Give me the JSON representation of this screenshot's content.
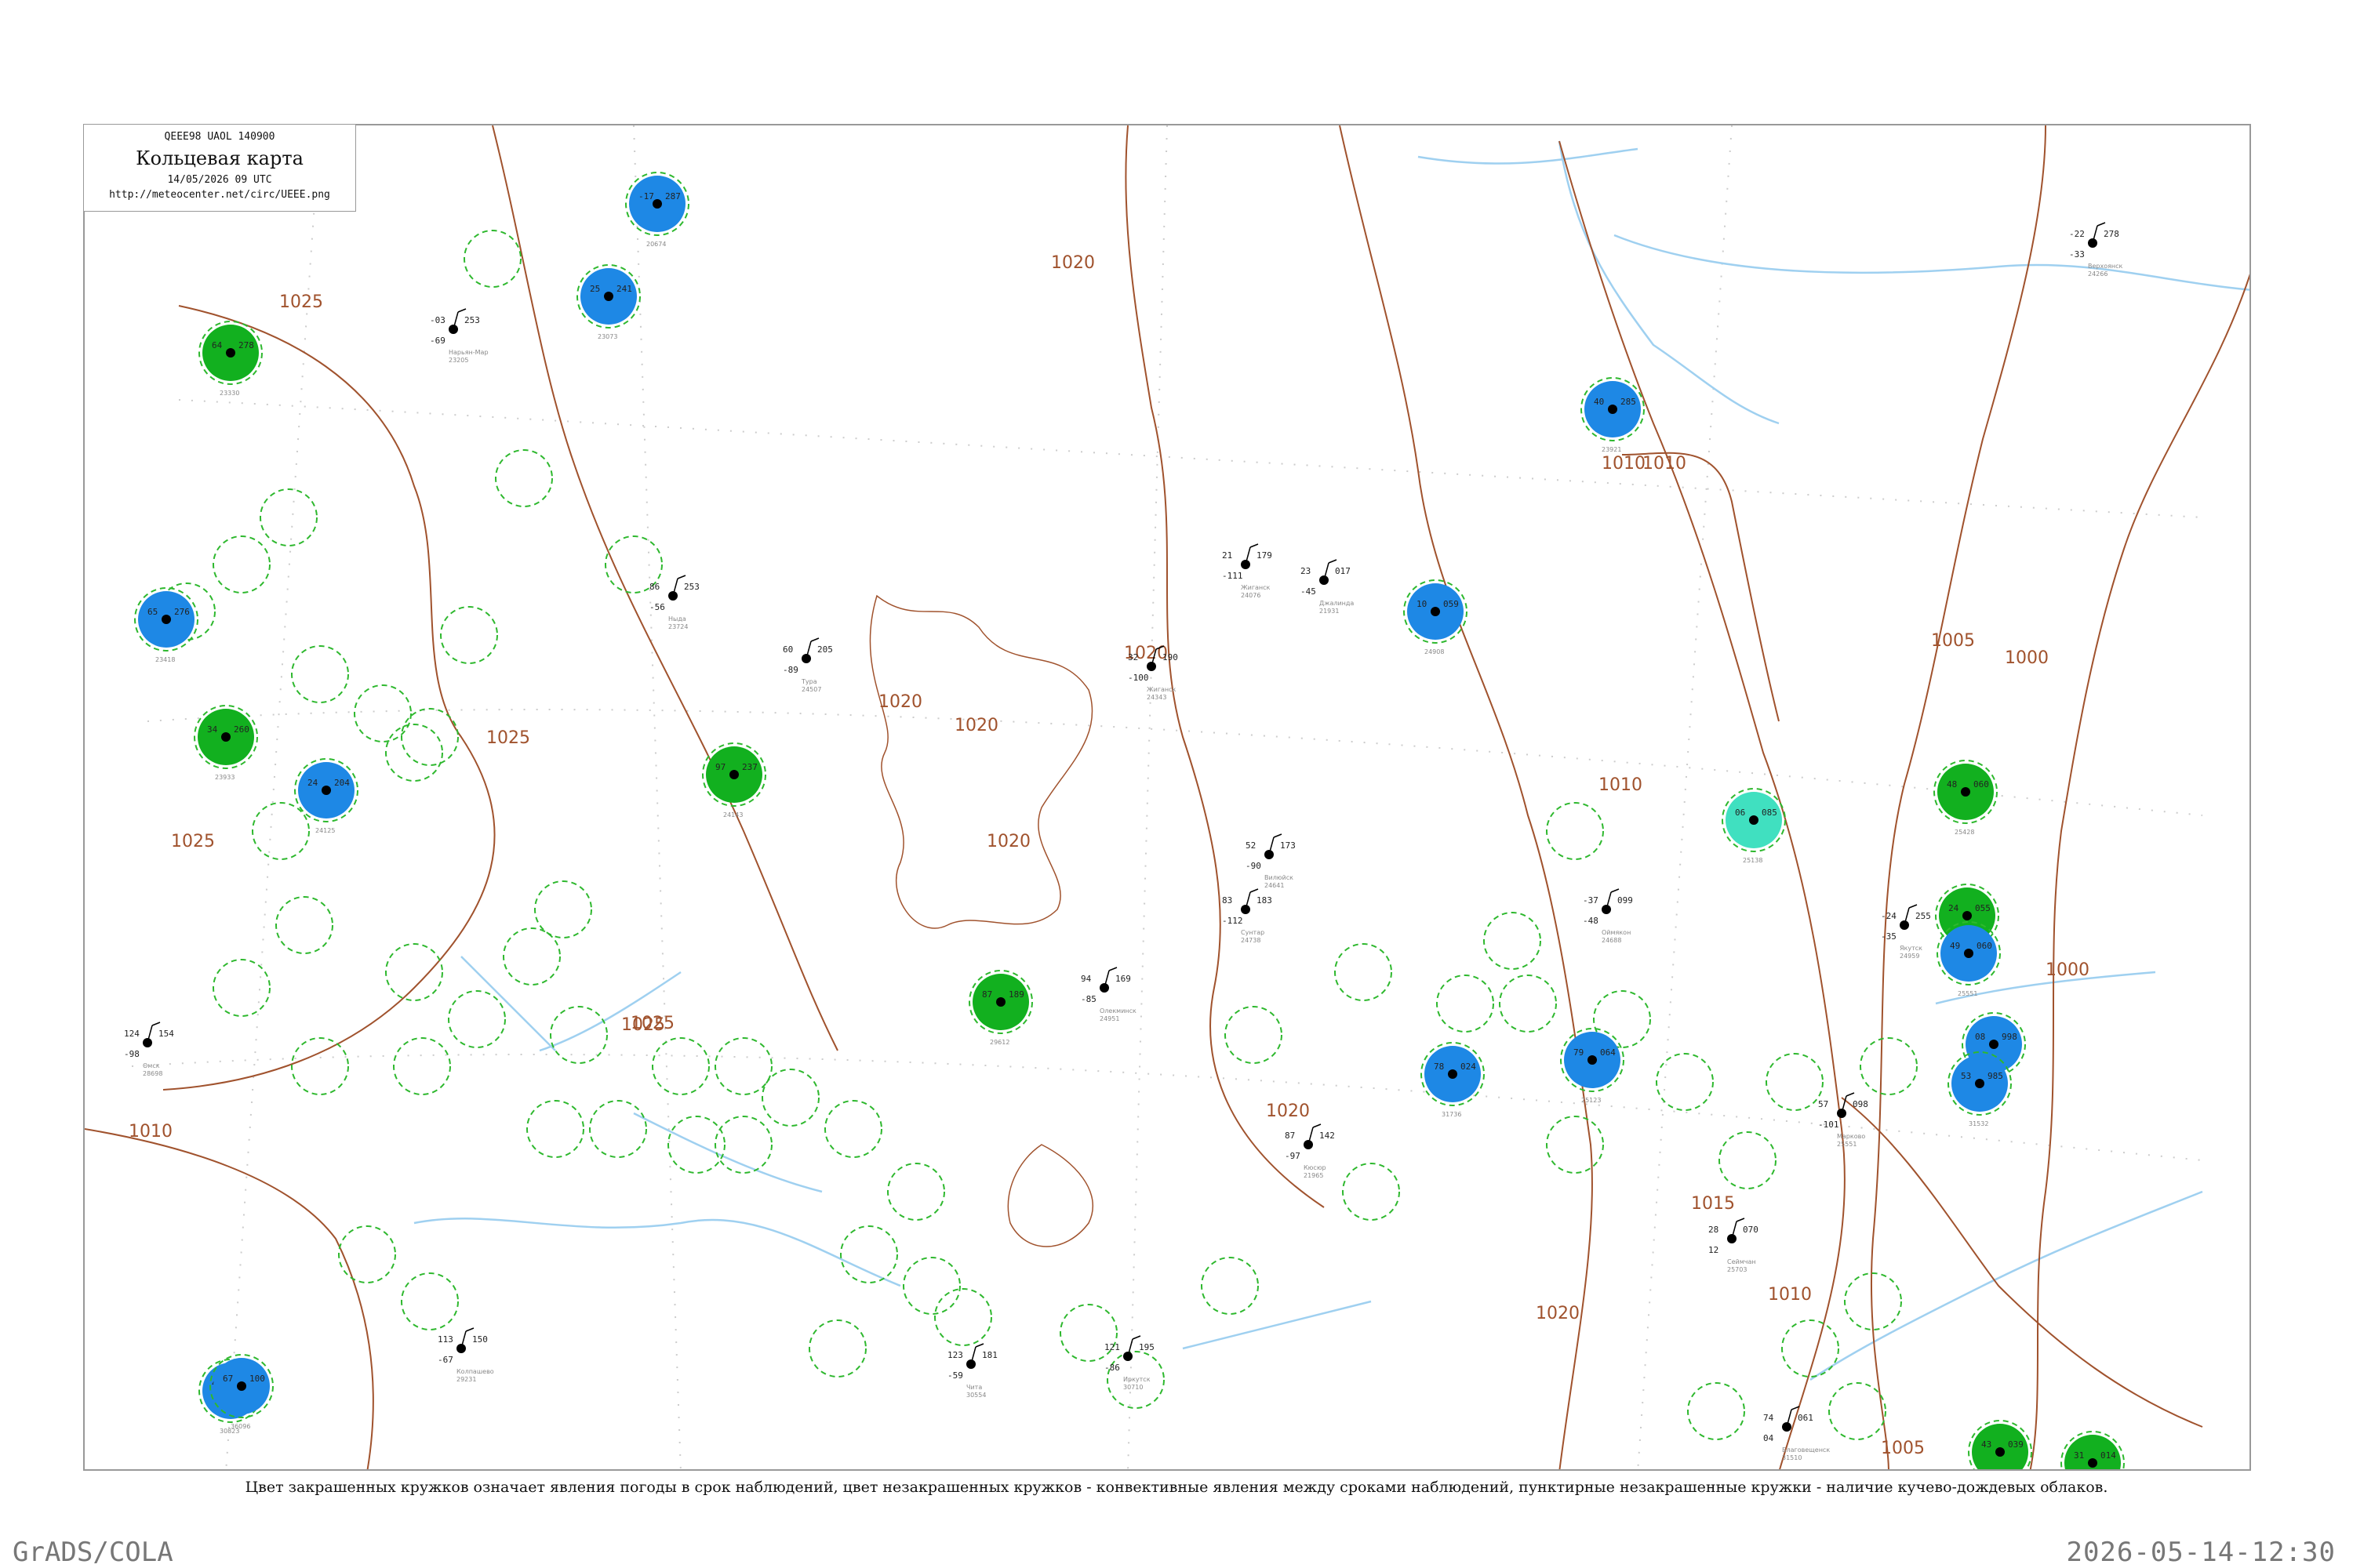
{
  "header": {
    "code": "QEEE98  UAOL  140900",
    "title": "Кольцевая карта",
    "datetime": "14/05/2026 09 UTC",
    "url": "http://meteocenter.net/circ/UEEE.png"
  },
  "caption": "Цвет закрашенных кружков означает явления погоды в срок наблюдений, цвет незакрашенных кружков - конвективные явления между сроками наблюдений, пунктирные незакрашенные кружки - наличие кучево-дождевых облаков.",
  "footer": {
    "left": "GrADS/COLA",
    "right": "2026-05-14-12:30"
  },
  "colors": {
    "isobar": "#a0522d",
    "river": "#9fd0f0",
    "coast": "#a0522d",
    "dashed_ring": "#2eb82e",
    "fill_rain": "#1e88e5",
    "fill_shower": "#12b01f",
    "fill_fog": "#40e0c0"
  },
  "isobar_labels": [
    "1025",
    "1020",
    "1020",
    "1020",
    "1020",
    "1025",
    "1025",
    "1020",
    "1015",
    "1010",
    "1010",
    "1010",
    "1005",
    "1005",
    "1000",
    "1000",
    "1025",
    "1020",
    "1010",
    "1025",
    "1020",
    "1010"
  ],
  "stations": [
    {
      "id": "24959",
      "name": "Якутск",
      "t": "-24",
      "p": "255",
      "td": "-35"
    },
    {
      "id": "24266",
      "name": "Верхоянск",
      "t": "-22",
      "p": "278",
      "td": "-33"
    },
    {
      "id": "21931",
      "name": "Джалинда",
      "t": "23",
      "p": "017",
      "td": "-45"
    },
    {
      "id": "21965",
      "name": "Кюсюр",
      "t": "87",
      "p": "142",
      "td": "-97"
    },
    {
      "id": "24688",
      "name": "Оймякон",
      "t": "-37",
      "p": "099",
      "td": "-48"
    },
    {
      "id": "24076",
      "name": "Жиганск",
      "t": "21",
      "p": "179",
      "td": "-111"
    },
    {
      "id": "24343",
      "name": "Жиганск",
      "t": "32",
      "p": "190",
      "td": "-100"
    },
    {
      "id": "24641",
      "name": "Вилюйск",
      "t": "52",
      "p": "173",
      "td": "-90"
    },
    {
      "id": "24738",
      "name": "Сунтар",
      "t": "83",
      "p": "183",
      "td": "-112"
    },
    {
      "id": "24951",
      "name": "Олекминск",
      "t": "94",
      "p": "169",
      "td": "-85"
    },
    {
      "id": "25551",
      "name": "Марково",
      "t": "57",
      "p": "098",
      "td": "-101"
    },
    {
      "id": "25703",
      "name": "Сеймчан",
      "t": "28",
      "p": "070",
      "td": "12"
    },
    {
      "id": "31510",
      "name": "Благовещенск",
      "t": "74",
      "p": "061",
      "td": "04"
    },
    {
      "id": "30554",
      "name": "Чита",
      "t": "123",
      "p": "181",
      "td": "-59"
    },
    {
      "id": "30710",
      "name": "Иркутск",
      "t": "121",
      "p": "195",
      "td": "-86"
    },
    {
      "id": "29231",
      "name": "Колпашево",
      "t": "113",
      "p": "150",
      "td": "-67"
    },
    {
      "id": "28698",
      "name": "Омск",
      "t": "124",
      "p": "154",
      "td": "-98"
    },
    {
      "id": "23205",
      "name": "Нарьян-Мар",
      "t": "-03",
      "p": "253",
      "td": "-69"
    },
    {
      "id": "23724",
      "name": "Ныда",
      "t": "86",
      "p": "253",
      "td": "-56"
    },
    {
      "id": "24507",
      "name": "Тура",
      "t": "60",
      "p": "205",
      "td": "-89"
    }
  ],
  "wx_filled_stations": [
    {
      "kind": "rain",
      "id": "20674",
      "t": "-17",
      "p": "287"
    },
    {
      "kind": "rain",
      "id": "23073",
      "t": "25",
      "p": "241"
    },
    {
      "kind": "shower",
      "id": "23330",
      "t": "64",
      "p": "278"
    },
    {
      "kind": "rain",
      "id": "23418",
      "t": "65",
      "p": "276"
    },
    {
      "kind": "rain",
      "id": "23921",
      "t": "40",
      "p": "285"
    },
    {
      "kind": "shower",
      "id": "23933",
      "t": "34",
      "p": "260"
    },
    {
      "kind": "rain",
      "id": "24125",
      "t": "24",
      "p": "204"
    },
    {
      "kind": "shower",
      "id": "24143",
      "t": "97",
      "p": "237"
    },
    {
      "kind": "shower",
      "id": "29612",
      "t": "87",
      "p": "189"
    },
    {
      "kind": "rain",
      "id": "24908",
      "t": "10",
      "p": "059"
    },
    {
      "kind": "rain",
      "id": "25123",
      "t": "79",
      "p": "064"
    },
    {
      "kind": "shower",
      "id": "25206",
      "t": "24",
      "p": "055"
    },
    {
      "kind": "fog",
      "id": "25138",
      "t": "06",
      "p": "085"
    },
    {
      "kind": "shower",
      "id": "25428",
      "t": "48",
      "p": "060"
    },
    {
      "kind": "rain",
      "id": "25551",
      "t": "49",
      "p": "060"
    },
    {
      "kind": "rain",
      "id": "31416",
      "t": "08",
      "p": "998"
    },
    {
      "kind": "rain",
      "id": "31532",
      "t": "53",
      "p": "985"
    },
    {
      "kind": "rain",
      "id": "31736",
      "t": "78",
      "p": "024"
    },
    {
      "kind": "rain",
      "id": "30823",
      "t": "47",
      "p": "119"
    },
    {
      "kind": "shower",
      "id": "31707",
      "t": "31",
      "p": "014"
    },
    {
      "kind": "shower",
      "id": "31735",
      "t": "43",
      "p": "039"
    },
    {
      "kind": "rain",
      "id": "36096",
      "t": "67",
      "p": "100"
    }
  ]
}
